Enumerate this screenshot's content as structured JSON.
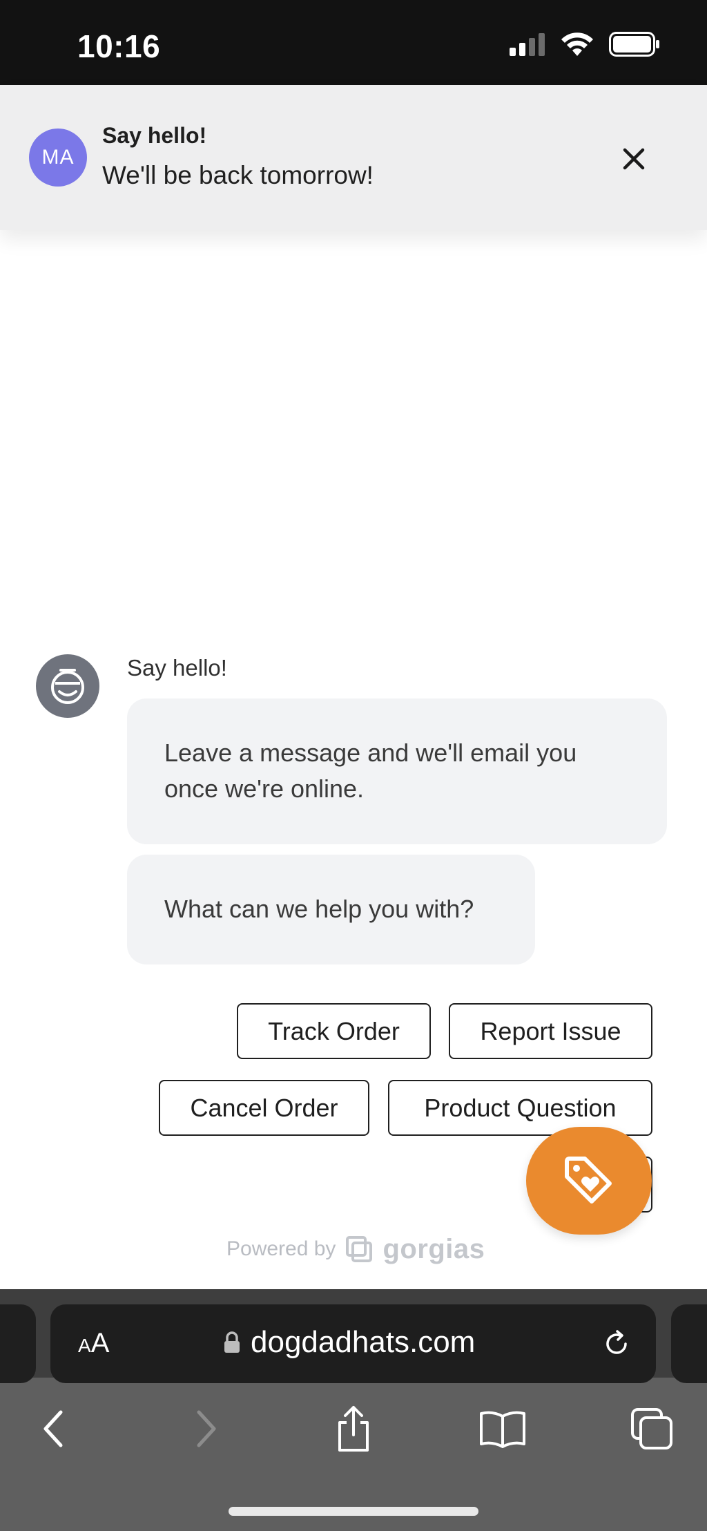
{
  "status_bar": {
    "time": "10:16"
  },
  "notification": {
    "avatar_initials": "MA",
    "title": "Say hello!",
    "body": "We'll be back tomorrow!"
  },
  "chat": {
    "bot_name": "Say hello!",
    "messages": [
      "Leave a message and we'll email you once we're online.",
      "What can we help you with?"
    ],
    "quick_replies": [
      "Track Order",
      "Report Issue",
      "Cancel Order",
      "Product Question"
    ],
    "powered_by": "Powered by",
    "brand": "gorgias"
  },
  "browser": {
    "aa_small": "A",
    "aa_large": "A",
    "url": "dogdadhats.com"
  },
  "colors": {
    "avatar": "#7b78e8",
    "fab": "#ea8a2e",
    "bubble": "#f2f3f5"
  }
}
